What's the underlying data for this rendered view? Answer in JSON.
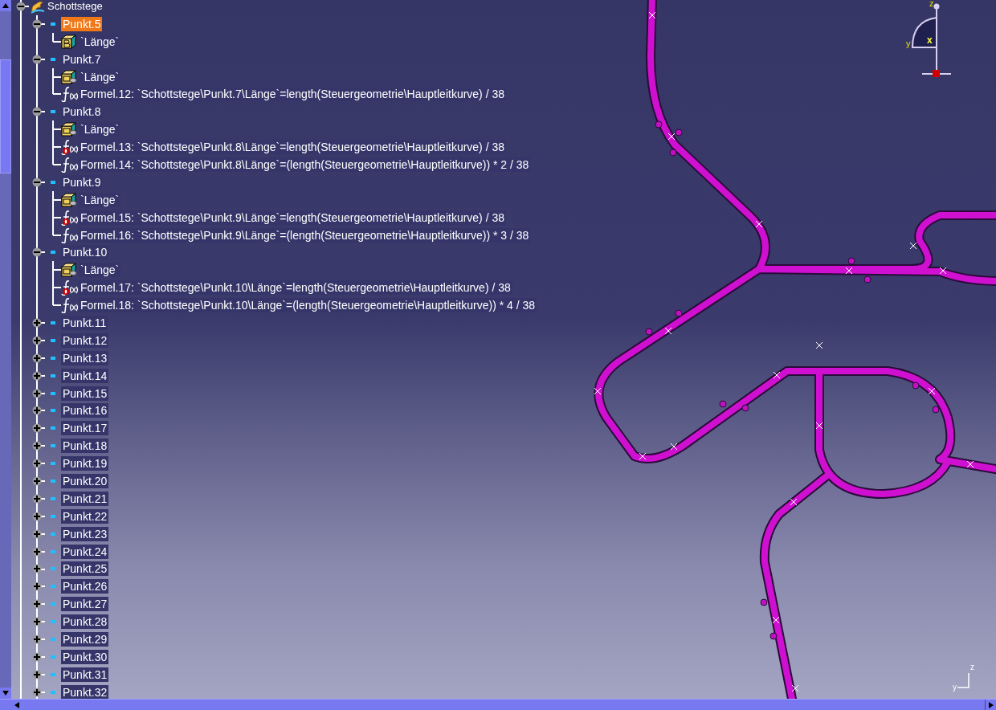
{
  "tree": {
    "label": "Schottstege",
    "expanded": true,
    "selected": false,
    "children": [
      {
        "label": "Punkt.5",
        "selected": true,
        "expanded": true,
        "children": [
          {
            "kind": "parameter",
            "label": "`Länge`",
            "formula_driven": false,
            "selected": false
          }
        ]
      },
      {
        "label": "Punkt.7",
        "selected": false,
        "expanded": true,
        "children": [
          {
            "kind": "parameter",
            "label": "`Länge`",
            "formula_driven": true,
            "selected": false
          },
          {
            "kind": "formula",
            "label": "Formel.12: `Schottstege\\Punkt.7\\Länge`=length(Steuergeometrie\\Hauptleitkurve) / 38",
            "flagged": false,
            "selected": false
          }
        ]
      },
      {
        "label": "Punkt.8",
        "selected": false,
        "expanded": true,
        "children": [
          {
            "kind": "parameter",
            "label": "`Länge`",
            "formula_driven": true,
            "selected": false
          },
          {
            "kind": "formula",
            "label": "Formel.13: `Schottstege\\Punkt.8\\Länge`=length(Steuergeometrie\\Hauptleitkurve) / 38",
            "flagged": true,
            "selected": false
          },
          {
            "kind": "formula",
            "label": "Formel.14: `Schottstege\\Punkt.8\\Länge`=(length(Steuergeometrie\\Hauptleitkurve)) * 2 / 38",
            "flagged": false,
            "selected": false
          }
        ]
      },
      {
        "label": "Punkt.9",
        "selected": false,
        "expanded": true,
        "children": [
          {
            "kind": "parameter",
            "label": "`Länge`",
            "formula_driven": true,
            "selected": false
          },
          {
            "kind": "formula",
            "label": "Formel.15: `Schottstege\\Punkt.9\\Länge`=length(Steuergeometrie\\Hauptleitkurve) / 38",
            "flagged": true,
            "selected": false
          },
          {
            "kind": "formula",
            "label": "Formel.16: `Schottstege\\Punkt.9\\Länge`=(length(Steuergeometrie\\Hauptleitkurve)) * 3 / 38",
            "flagged": false,
            "selected": false
          }
        ]
      },
      {
        "label": "Punkt.10",
        "selected": false,
        "expanded": true,
        "children": [
          {
            "kind": "parameter",
            "label": "`Länge`",
            "formula_driven": true,
            "selected": false
          },
          {
            "kind": "formula",
            "label": "Formel.17: `Schottstege\\Punkt.10\\Länge`=length(Steuergeometrie\\Hauptleitkurve) / 38",
            "flagged": true,
            "selected": false
          },
          {
            "kind": "formula",
            "label": "Formel.18: `Schottstege\\Punkt.10\\Länge`=(length(Steuergeometrie\\Hauptleitkurve)) * 4 / 38",
            "flagged": false,
            "selected": false
          }
        ]
      },
      {
        "label": "Punkt.11",
        "selected": false,
        "expanded": false
      },
      {
        "label": "Punkt.12",
        "selected": false,
        "expanded": false
      },
      {
        "label": "Punkt.13",
        "selected": false,
        "expanded": false
      },
      {
        "label": "Punkt.14",
        "selected": false,
        "expanded": false
      },
      {
        "label": "Punkt.15",
        "selected": false,
        "expanded": false
      },
      {
        "label": "Punkt.16",
        "selected": false,
        "expanded": false
      },
      {
        "label": "Punkt.17",
        "selected": false,
        "expanded": false
      },
      {
        "label": "Punkt.18",
        "selected": false,
        "expanded": false
      },
      {
        "label": "Punkt.19",
        "selected": false,
        "expanded": false
      },
      {
        "label": "Punkt.20",
        "selected": false,
        "expanded": false
      },
      {
        "label": "Punkt.21",
        "selected": false,
        "expanded": false
      },
      {
        "label": "Punkt.22",
        "selected": false,
        "expanded": false
      },
      {
        "label": "Punkt.23",
        "selected": false,
        "expanded": false
      },
      {
        "label": "Punkt.24",
        "selected": false,
        "expanded": false
      },
      {
        "label": "Punkt.25",
        "selected": false,
        "expanded": false
      },
      {
        "label": "Punkt.26",
        "selected": false,
        "expanded": false
      },
      {
        "label": "Punkt.27",
        "selected": false,
        "expanded": false
      },
      {
        "label": "Punkt.28",
        "selected": false,
        "expanded": false
      },
      {
        "label": "Punkt.29",
        "selected": false,
        "expanded": false
      },
      {
        "label": "Punkt.30",
        "selected": false,
        "expanded": false
      },
      {
        "label": "Punkt.31",
        "selected": false,
        "expanded": false
      },
      {
        "label": "Punkt.32",
        "selected": false,
        "expanded": false
      }
    ]
  },
  "compass": {
    "z": "z",
    "y": "y",
    "x": "x"
  },
  "axis_triad": {
    "z": "z",
    "y": "y"
  }
}
